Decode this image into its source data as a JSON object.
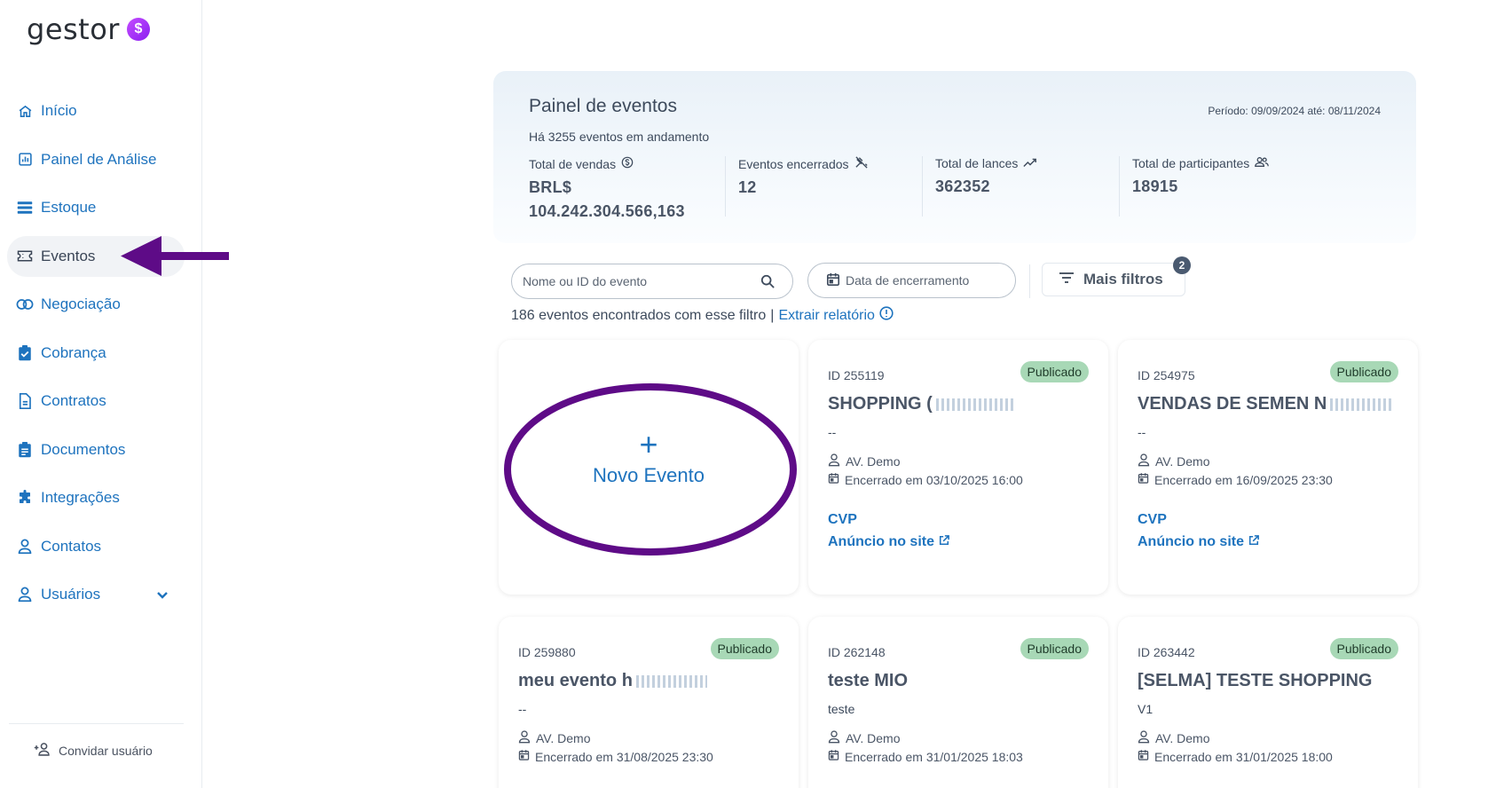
{
  "brand": {
    "name": "gestor",
    "badge": "$"
  },
  "sidebar": {
    "items": [
      {
        "label": "Início",
        "icon": "home-icon"
      },
      {
        "label": "Painel de Análise",
        "icon": "chart-icon"
      },
      {
        "label": "Estoque",
        "icon": "list-icon"
      },
      {
        "label": "Eventos",
        "icon": "ticket-icon",
        "active": true
      },
      {
        "label": "Negociação",
        "icon": "circles-icon"
      },
      {
        "label": "Cobrança",
        "icon": "clipboard-check-icon"
      },
      {
        "label": "Contratos",
        "icon": "document-icon"
      },
      {
        "label": "Documentos",
        "icon": "clipboard-icon"
      },
      {
        "label": "Integrações",
        "icon": "puzzle-icon"
      },
      {
        "label": "Contatos",
        "icon": "person-icon"
      },
      {
        "label": "Usuários",
        "icon": "user-icon"
      }
    ],
    "invite_label": "Convidar usuário"
  },
  "panel": {
    "title": "Painel de eventos",
    "subtitle": "Há 3255 eventos em andamento",
    "period": "Período: 09/09/2024 até: 08/11/2024",
    "stats": [
      {
        "label": "Total de vendas",
        "value": "BRL$ 104.242.304.566,163",
        "icon": "dollar-circle-icon"
      },
      {
        "label": "Eventos encerrados",
        "value": "12",
        "icon": "gavel-off-icon"
      },
      {
        "label": "Total de lances",
        "value": "362352",
        "icon": "trend-up-icon"
      },
      {
        "label": "Total de participantes",
        "value": "18915",
        "icon": "people-icon"
      }
    ]
  },
  "filters": {
    "search_placeholder": "Nome ou ID do evento",
    "date_placeholder": "Data de encerramento",
    "more_filters_label": "Mais filtros",
    "more_filters_count": "2",
    "results_text": "186 eventos encontrados com esse filtro",
    "report_link": "Extrair relatório"
  },
  "new_event": {
    "plus": "+",
    "label": "Novo Evento"
  },
  "cards": [
    {
      "id": "ID 255119",
      "status": "Publicado",
      "title": "SHOPPING (",
      "desc": "--",
      "author": "AV. Demo",
      "date": "Encerrado em 03/10/2025 16:00",
      "type": "CVP",
      "link": "Anúncio no site"
    },
    {
      "id": "ID 254975",
      "status": "Publicado",
      "title": "VENDAS DE SEMEN N",
      "desc": "--",
      "author": "AV. Demo",
      "date": "Encerrado em 16/09/2025 23:30",
      "type": "CVP",
      "link": "Anúncio no site"
    },
    {
      "id": "ID 259880",
      "status": "Publicado",
      "title": "meu evento h",
      "desc": "--",
      "author": "AV. Demo",
      "date": "Encerrado em 31/08/2025 23:30"
    },
    {
      "id": "ID 262148",
      "status": "Publicado",
      "title": "teste MIO",
      "desc": "teste",
      "author": "AV. Demo",
      "date": "Encerrado em 31/01/2025 18:03"
    },
    {
      "id": "ID 263442",
      "status": "Publicado",
      "title": "[SELMA] TESTE SHOPPING",
      "desc": "V1",
      "author": "AV. Demo",
      "date": "Encerrado em 31/01/2025 18:00"
    }
  ],
  "colors": {
    "accent": "#1e73be",
    "annotation": "#5e0b87",
    "status_bg": "#a8d8b6"
  }
}
